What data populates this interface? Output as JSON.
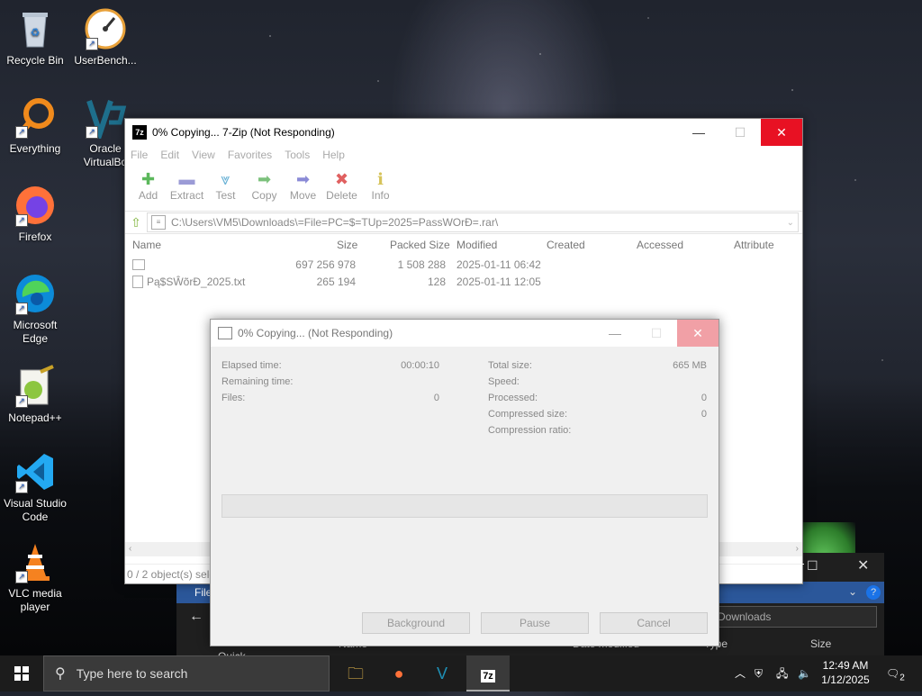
{
  "desktop": {
    "icons": [
      {
        "label": "Recycle Bin"
      },
      {
        "label": "UserBench..."
      },
      {
        "label": "Everything"
      },
      {
        "label": "Oracle VirtualBo"
      },
      {
        "label": "Firefox"
      },
      {
        "label": "Microsoft Edge"
      },
      {
        "label": "Notepad++"
      },
      {
        "label": "Visual Studio Code"
      },
      {
        "label": "VLC media player"
      }
    ]
  },
  "main_window": {
    "title": "0% Copying... 7-Zip (Not Responding)",
    "app_icon_text": "7z",
    "menu": [
      "File",
      "Edit",
      "View",
      "Favorites",
      "Tools",
      "Help"
    ],
    "toolbar": [
      {
        "label": "Add",
        "icon": "plus-icon",
        "color": "#5cb85c"
      },
      {
        "label": "Extract",
        "icon": "minus-icon",
        "color": "#9b9bd6"
      },
      {
        "label": "Test",
        "icon": "check-down-icon",
        "color": "#6ab2d6"
      },
      {
        "label": "Copy",
        "icon": "arrow-right-icon",
        "color": "#7cc17c"
      },
      {
        "label": "Move",
        "icon": "arrow-right-icon",
        "color": "#8a8ad6"
      },
      {
        "label": "Delete",
        "icon": "x-icon",
        "color": "#e06060"
      },
      {
        "label": "Info",
        "icon": "info-icon",
        "color": "#d6c35a"
      }
    ],
    "address": "C:\\Users\\VM5\\Downloads\\=File=PC=$=TUp=2025=PassWOrĐ=.rar\\",
    "columns": [
      "Name",
      "Size",
      "Packed Size",
      "Modified",
      "Created",
      "Accessed",
      "Attribute"
    ],
    "rows": [
      {
        "name": "",
        "size": "697 256 978",
        "packed": "1 508 288",
        "modified": "2025-01-11 06:42"
      },
      {
        "name": "Pą$SŴõrĐ_2025.txt",
        "size": "265 194",
        "packed": "128",
        "modified": "2025-01-11 12:05"
      }
    ],
    "status": "0 / 2 object(s) sele"
  },
  "copy_dialog": {
    "title": "0% Copying... (Not Responding)",
    "left_stats": [
      {
        "label": "Elapsed time:",
        "value": "00:00:10"
      },
      {
        "label": "Remaining time:",
        "value": ""
      },
      {
        "label": "Files:",
        "value": "0"
      }
    ],
    "right_stats": [
      {
        "label": "Total size:",
        "value": "665 MB"
      },
      {
        "label": "Speed:",
        "value": ""
      },
      {
        "label": "Processed:",
        "value": "0"
      },
      {
        "label": "Compressed size:",
        "value": "0"
      },
      {
        "label": "Compression ratio:",
        "value": ""
      }
    ],
    "progress": 0,
    "buttons": {
      "background": "Background",
      "pause": "Pause",
      "cancel": "Cancel"
    }
  },
  "explorer_behind": {
    "ribbon_tab": "File",
    "search_placeholder": "rch Downloads",
    "headers": [
      "Name",
      "Date modified",
      "Type",
      "Size"
    ],
    "nav_item": "Quick"
  },
  "taskbar": {
    "search_placeholder": "Type here to search",
    "clock_time": "12:49 AM",
    "clock_date": "1/12/2025",
    "notification_count": "2"
  }
}
